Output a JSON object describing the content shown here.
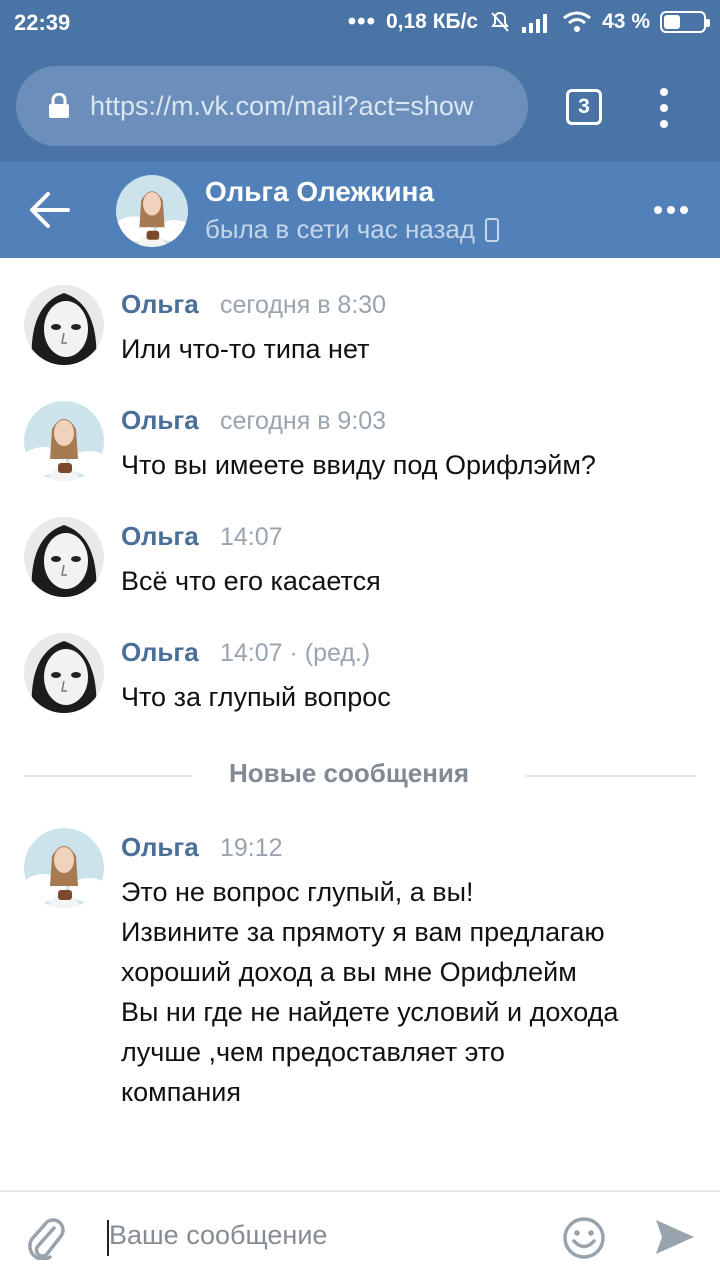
{
  "status_bar": {
    "time": "22:39",
    "dots": "•••",
    "speed": "0,18 КБ/с",
    "battery": "43 %",
    "battery_level": 0.43
  },
  "browser": {
    "url": "https://m.vk.com/mail?act=show",
    "tab_count": "3"
  },
  "header": {
    "name": "Ольга Олежкина",
    "status": "была в сети час назад"
  },
  "messages": [
    {
      "author": "Ольга",
      "time": "сегодня в 8:30",
      "text": "Или что-то типа нет",
      "avatar": "bw-photo"
    },
    {
      "author": "Ольга",
      "time": "сегодня в 9:03",
      "text": "Что вы имеете ввиду под Орифлэйм?",
      "avatar": "color-photo"
    },
    {
      "author": "Ольга",
      "time": "14:07",
      "text": "Всё что его касается",
      "avatar": "bw-photo"
    },
    {
      "author": "Ольга",
      "time": "14:07 · (ред.)",
      "text": "Что за глупый вопрос",
      "avatar": "bw-photo"
    }
  ],
  "divider_label": "Новые сообщения",
  "new_message": {
    "author": "Ольга",
    "time": "19:12",
    "lines": [
      "Это не вопрос глупый, а вы!",
      "Извините за прямоту я вам предлагаю",
      "хороший доход а вы мне Орифлейм",
      "Вы ни где не найдете условий и дохода",
      "лучше ,чем предоставляет это",
      "компания"
    ]
  },
  "composer": {
    "placeholder": "Ваше сообщение"
  },
  "colors": {
    "status_bar": "#4a74a5",
    "header": "#5181b8",
    "author": "#4a6f99"
  }
}
